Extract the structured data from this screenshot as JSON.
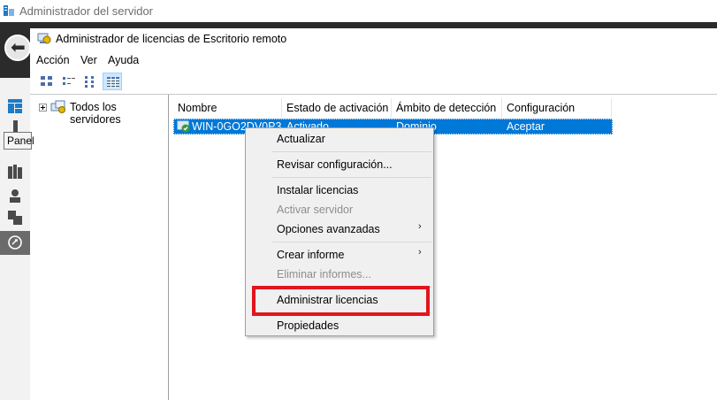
{
  "outer_window": {
    "title": "Administrador del servidor"
  },
  "tooltip": {
    "text": "Panel"
  },
  "inner_window": {
    "title": "Administrador de licencias de Escritorio remoto"
  },
  "menubar": {
    "items": [
      "Acción",
      "Ver",
      "Ayuda"
    ]
  },
  "tree": {
    "root_label": "Todos los servidores"
  },
  "list": {
    "columns": [
      "Nombre",
      "Estado de activación",
      "Ámbito de detección",
      "Configuración"
    ],
    "row": {
      "name": "WIN-0GO2DV0P3",
      "status": "Activado",
      "scope": "Dominio",
      "config": "Aceptar"
    }
  },
  "context_menu": {
    "items": [
      {
        "label": "Actualizar",
        "enabled": true
      },
      {
        "label": "Revisar configuración...",
        "enabled": true
      },
      {
        "label": "Instalar licencias",
        "enabled": true
      },
      {
        "label": "Activar servidor",
        "enabled": false
      },
      {
        "label": "Opciones avanzadas",
        "enabled": true,
        "submenu": true
      },
      {
        "label": "Crear informe",
        "enabled": true,
        "submenu": true
      },
      {
        "label": "Eliminar informes...",
        "enabled": false
      },
      {
        "label": "Administrar licencias",
        "enabled": true,
        "highlighted": true
      },
      {
        "label": "Propiedades",
        "enabled": true
      }
    ],
    "submenu_arrow": "›"
  },
  "colors": {
    "selection": "#0078d7",
    "highlight_box": "#e2141e",
    "sidebar_dark": "#2b2b2b"
  }
}
